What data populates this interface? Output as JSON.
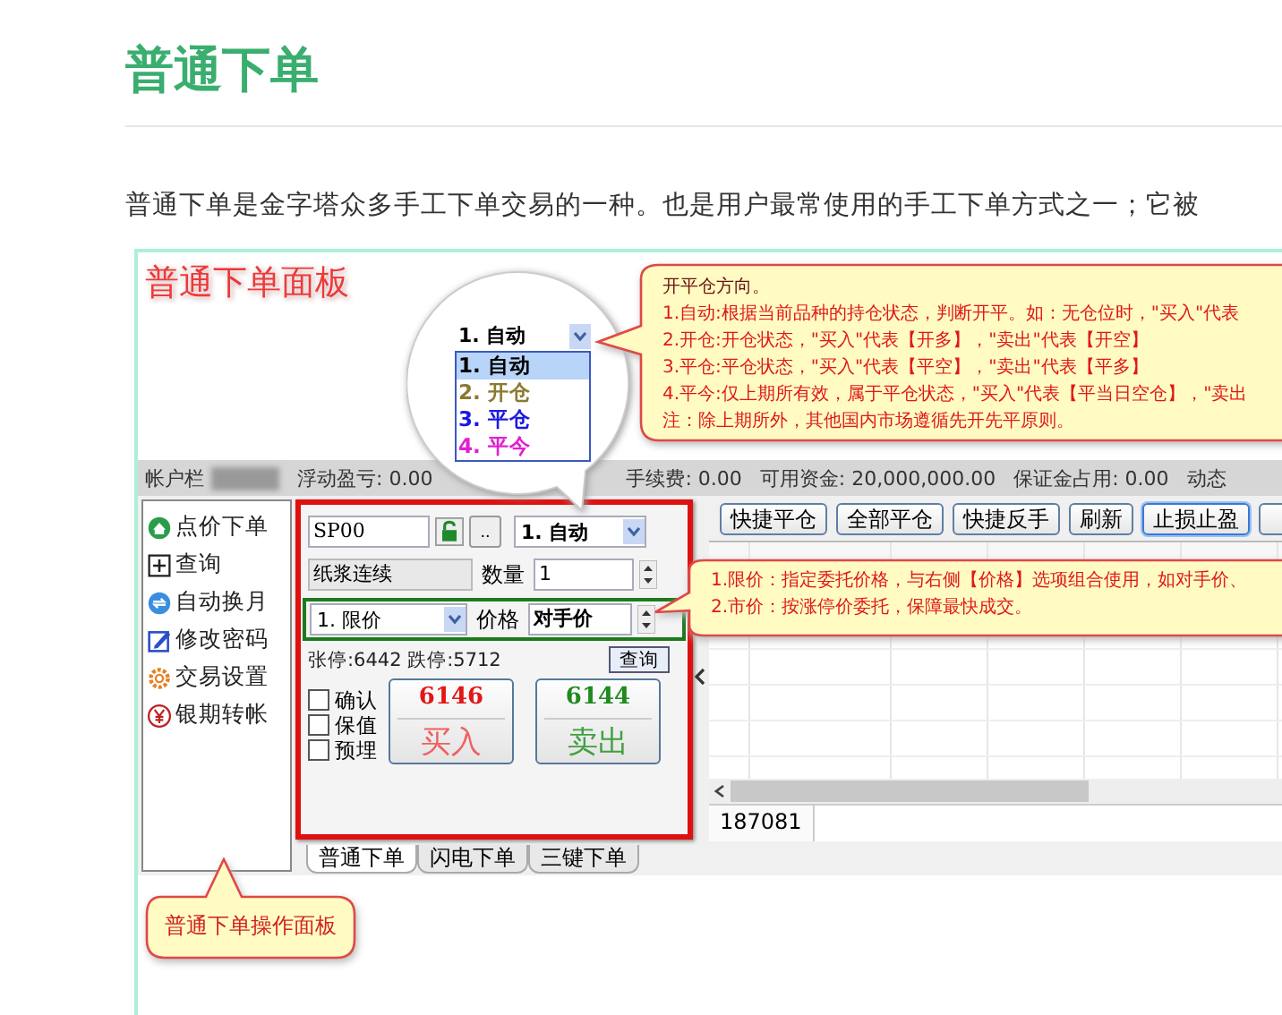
{
  "article": {
    "title": "普通下单",
    "paragraph": "普通下单是金字塔众多手工下单交易的一种。也是用户最常使用的手工下单方式之一；它被"
  },
  "figure": {
    "caption": "普通下单面板",
    "status_bar": {
      "label": "帐户栏",
      "fields": [
        "浮动盈亏: 0.00",
        "手续费: 0.00",
        "可用资金: 20,000,000.00",
        "保证金占用: 0.00",
        "动态"
      ]
    },
    "sidebar": [
      {
        "label": "点价下单",
        "kind": "house"
      },
      {
        "label": "查询",
        "kind": "plus-box"
      },
      {
        "label": "自动换月",
        "kind": "cycle"
      },
      {
        "label": "修改密码",
        "kind": "edit"
      },
      {
        "label": "交易设置",
        "kind": "gear"
      },
      {
        "label": "银期转帐",
        "kind": "yen"
      }
    ],
    "order_panel": {
      "contract": "SP00",
      "browse_button": "..",
      "direction": "1. 自动",
      "contract_name": "纸浆连续",
      "quantity_label": "数量",
      "quantity": "1",
      "price_type": "1. 限价",
      "price_label": "价格",
      "price": "对手价",
      "limits": "张停:6442 跌停:5712",
      "query_button": "查询",
      "options": [
        {
          "label": "确认",
          "checked": false
        },
        {
          "label": "保值",
          "checked": false
        },
        {
          "label": "预埋",
          "checked": false
        }
      ],
      "buy": {
        "price": "6146",
        "label": "买入"
      },
      "sell": {
        "price": "6144",
        "label": "卖出"
      }
    },
    "panel_tabs": [
      {
        "label": "普通下单",
        "selected": true
      },
      {
        "label": "闪电下单",
        "selected": false
      },
      {
        "label": "三键下单",
        "selected": false
      }
    ],
    "toolbar": [
      {
        "label": "快捷平仓",
        "selected": false
      },
      {
        "label": "全部平仓",
        "selected": false
      },
      {
        "label": "快捷反手",
        "selected": false
      },
      {
        "label": "刷新",
        "selected": false
      },
      {
        "label": "止损止盈",
        "selected": true
      }
    ],
    "account_tab": "187081",
    "direction_dropdown": {
      "value": "1. 自动",
      "options": [
        {
          "label": "1. 自动",
          "selected": true,
          "color": "#000000"
        },
        {
          "label": "2. 开仓",
          "selected": false,
          "color": "#8a7a30"
        },
        {
          "label": "3. 平仓",
          "selected": false,
          "color": "#1a1ae0"
        },
        {
          "label": "4. 平今",
          "selected": false,
          "color": "#e020d0"
        }
      ]
    },
    "callouts": [
      {
        "kind": "direction",
        "title": "开平仓方向。",
        "lines": [
          "1.自动:根据当前品种的持仓状态，判断开平。如：无仓位时，\"买入\"代表",
          "2.开仓:开仓状态，\"买入\"代表【开多】，\"卖出\"代表【开空】",
          "3.平仓:平仓状态，\"买入\"代表【平空】，\"卖出\"代表【平多】",
          "4.平今:仅上期所有效，属于平仓状态，\"买入\"代表【平当日空仓】，\"卖出",
          "注：除上期所外，其他国内市场遵循先开先平原则。"
        ]
      },
      {
        "kind": "price",
        "lines": [
          "1.限价：指定委托价格，与右侧【价格】选项组合使用，如对手价、",
          "2.市价：按涨停价委托，保障最快成交。"
        ]
      },
      {
        "kind": "panel",
        "lines": [
          "普通下单操作面板"
        ]
      }
    ]
  }
}
